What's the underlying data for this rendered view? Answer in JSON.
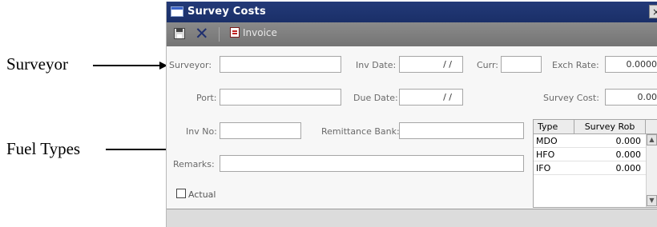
{
  "callouts": {
    "surveyor": "Surveyor",
    "fuel_types": "Fuel Types"
  },
  "window": {
    "title": "Survey Costs",
    "close_glyph": "×"
  },
  "toolbar": {
    "save_icon": "save-icon",
    "delete_glyph": "✕",
    "invoice_label": "Invoice"
  },
  "form": {
    "surveyor_label": "Surveyor:",
    "surveyor_value": "",
    "inv_date_label": "Inv Date:",
    "inv_date_value": "/ /",
    "curr_label": "Curr:",
    "curr_value": "",
    "exch_rate_label": "Exch Rate:",
    "exch_rate_value": "0.0000",
    "port_label": "Port:",
    "port_value": "",
    "due_date_label": "Due Date:",
    "due_date_value": "/ /",
    "survey_cost_label": "Survey Cost:",
    "survey_cost_value": "0.00",
    "inv_no_label": "Inv No:",
    "inv_no_value": "",
    "remittance_bank_label": "Remittance Bank:",
    "remittance_bank_value": "",
    "remarks_label": "Remarks:",
    "remarks_value": "",
    "actual_label": "Actual"
  },
  "fuel_grid": {
    "columns": [
      "Type",
      "Survey Rob"
    ],
    "rows": [
      {
        "type": "MDO",
        "rob": "0.000"
      },
      {
        "type": "HFO",
        "rob": "0.000"
      },
      {
        "type": "IFO",
        "rob": "0.000"
      }
    ],
    "scroll_up_glyph": "▲",
    "scroll_down_glyph": "▼"
  }
}
